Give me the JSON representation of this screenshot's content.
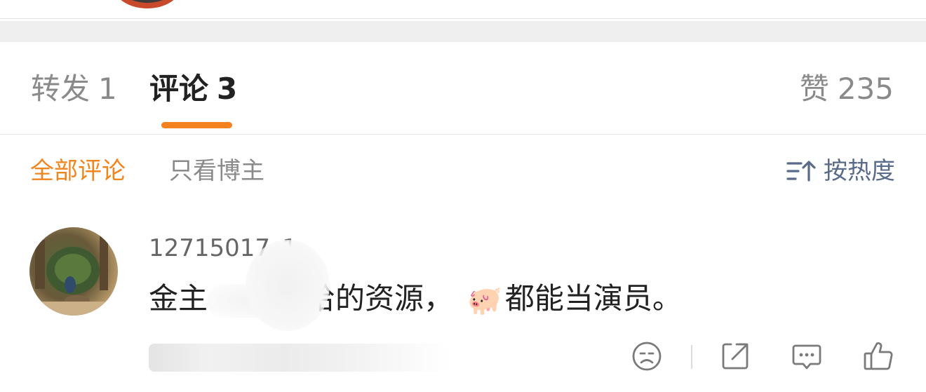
{
  "tabs": {
    "repost": {
      "label": "转发",
      "count": "1"
    },
    "comments": {
      "label": "评论",
      "count": "3"
    },
    "likes": {
      "label": "赞",
      "count": "235"
    }
  },
  "filters": {
    "all": "全部评论",
    "blogger_only": "只看博主",
    "sort": "按热度"
  },
  "comment": {
    "username": "12715017_1",
    "text_prefix": "金主",
    "text_middle": "给的资源，",
    "text_suffix": "都能当演员。",
    "emoji": "🐖"
  },
  "colors": {
    "accent": "#f5821f",
    "sort_text": "#5a6a8a",
    "icon": "#7a7a7a"
  },
  "icons": {
    "sort": "sort-hot-icon",
    "reaction": "sad-face-icon",
    "share": "share-icon",
    "reply": "comment-bubble-icon",
    "like": "thumbs-up-icon"
  }
}
